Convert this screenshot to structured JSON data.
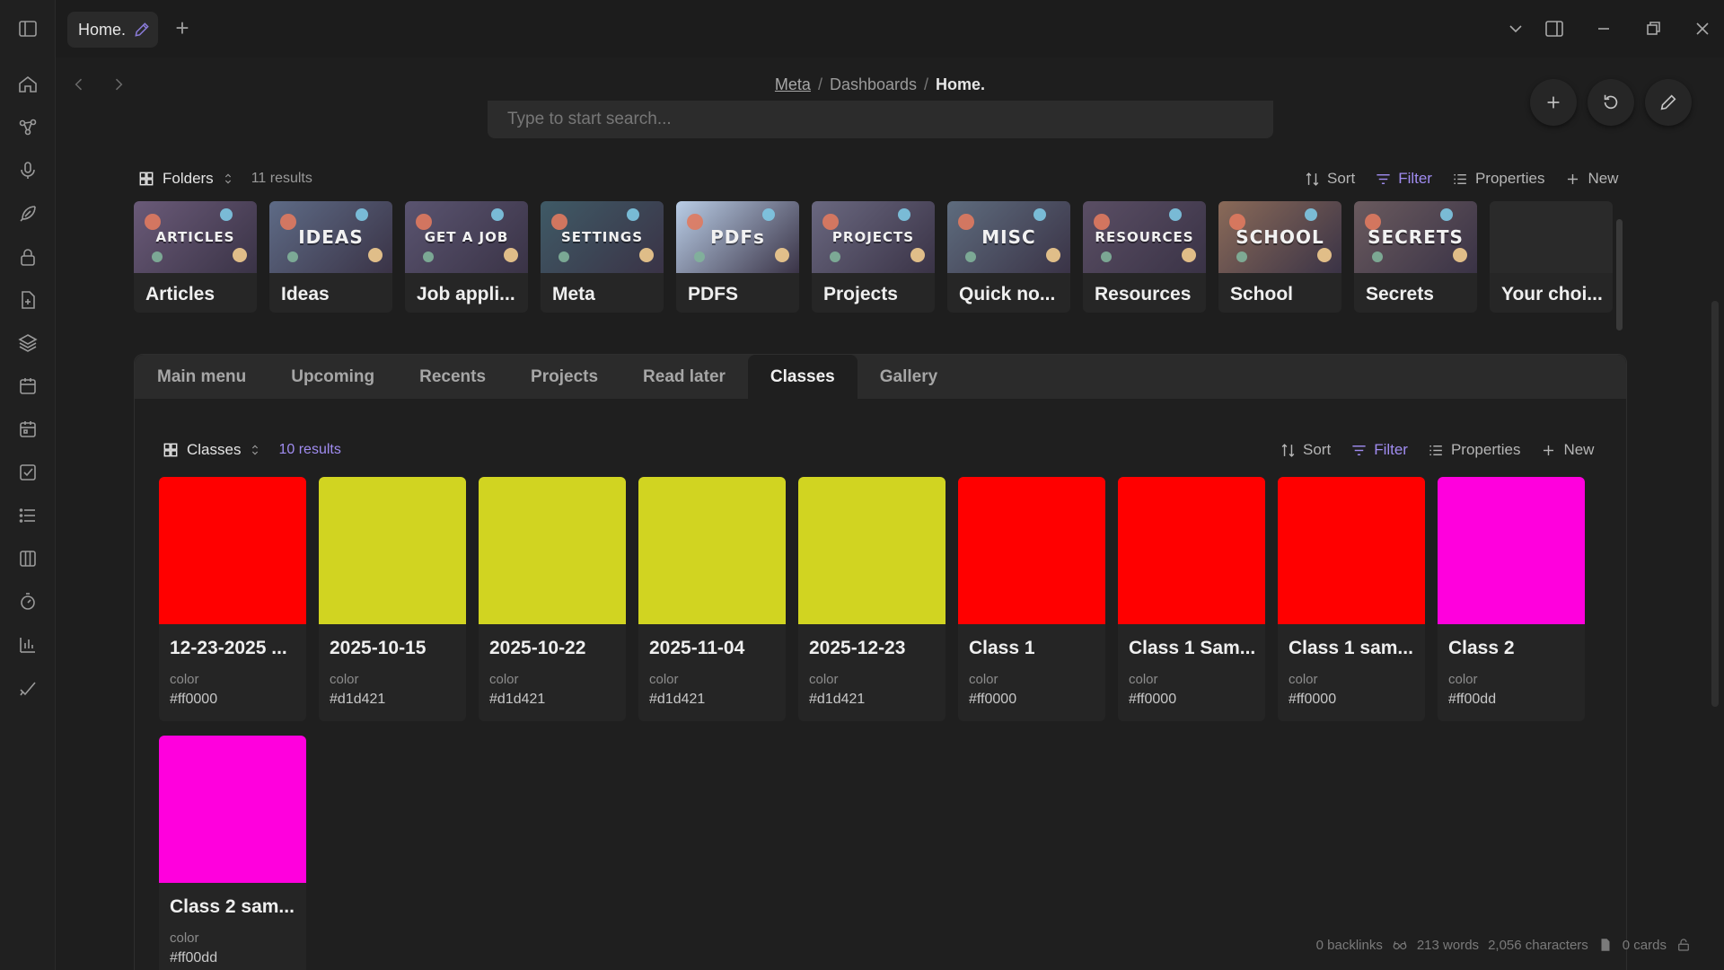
{
  "window": {
    "tab_title": "Home.",
    "new_tab_symbol": "+"
  },
  "breadcrumb": {
    "items": [
      "Meta",
      "Dashboards",
      "Home."
    ],
    "separator": "/"
  },
  "search": {
    "placeholder": "Type to start search..."
  },
  "folders_base": {
    "view_name": "Folders",
    "count": "11 results",
    "toolbar": {
      "sort": "Sort",
      "filter": "Filter",
      "properties": "Properties",
      "new": "New"
    },
    "cards": [
      {
        "title": "Articles",
        "word": "ARTICLES",
        "bg": "#6a5a78"
      },
      {
        "title": "Ideas",
        "word": "IDEAS",
        "bg": "#5e6b86"
      },
      {
        "title": "Job appli...",
        "word": "GET A JOB",
        "bg": "#5a5470"
      },
      {
        "title": "Meta",
        "word": "SETTINGS",
        "bg": "#3f5a66"
      },
      {
        "title": "PDFS",
        "word": "PDFs",
        "bg": "#b9cde6"
      },
      {
        "title": "Projects",
        "word": "PROJECTS",
        "bg": "#6a6880"
      },
      {
        "title": "Quick no...",
        "word": "MISC",
        "bg": "#5e6c7e"
      },
      {
        "title": "Resources",
        "word": "RESOURCES",
        "bg": "#5a4e64"
      },
      {
        "title": "School",
        "word": "SCHOOL",
        "bg": "#8a6a58"
      },
      {
        "title": "Secrets",
        "word": "SECRETS",
        "bg": "#6a5a5e"
      },
      {
        "title": "Your choi...",
        "word": "",
        "bg": "#2a2a2a"
      }
    ]
  },
  "panel_tabs": {
    "items": [
      "Main menu",
      "Upcoming",
      "Recents",
      "Projects",
      "Read later",
      "Classes",
      "Gallery"
    ],
    "active": "Classes"
  },
  "classes_base": {
    "view_name": "Classes",
    "count": "10 results",
    "toolbar": {
      "sort": "Sort",
      "filter": "Filter",
      "properties": "Properties",
      "new": "New"
    },
    "property_label": "color",
    "cards": [
      {
        "title": "12-23-2025 ...",
        "color": "#ff0000"
      },
      {
        "title": "2025-10-15",
        "color": "#d1d421"
      },
      {
        "title": "2025-10-22",
        "color": "#d1d421"
      },
      {
        "title": "2025-11-04",
        "color": "#d1d421"
      },
      {
        "title": "2025-12-23",
        "color": "#d1d421"
      },
      {
        "title": "Class 1",
        "color": "#ff0000"
      },
      {
        "title": "Class 1 Sam...",
        "color": "#ff0000"
      },
      {
        "title": "Class 1 sam...",
        "color": "#ff0000"
      },
      {
        "title": "Class 2",
        "color": "#ff00dd"
      },
      {
        "title": "Class 2 sam...",
        "color": "#ff00dd"
      }
    ]
  },
  "status_bar": {
    "backlinks": "0 backlinks",
    "words": "213 words",
    "characters": "2,056 characters",
    "cards": "0 cards"
  },
  "colors": {
    "accent": "#a08cf0",
    "background": "#1e1e1e"
  }
}
